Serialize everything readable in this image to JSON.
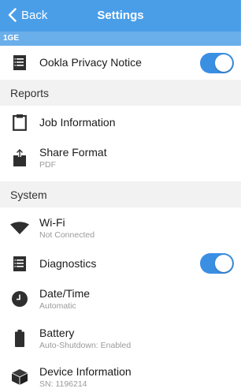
{
  "navbar": {
    "back_label": "Back",
    "title": "Settings"
  },
  "subbar": {
    "label": "1GE"
  },
  "privacy": {
    "title": "Ookla Privacy Notice",
    "toggle_on": true
  },
  "reports": {
    "header": "Reports",
    "items": [
      {
        "title": "Job Information",
        "subtitle": ""
      },
      {
        "title": "Share Format",
        "subtitle": "PDF"
      }
    ]
  },
  "system": {
    "header": "System",
    "items": [
      {
        "title": "Wi-Fi",
        "subtitle": "Not Connected"
      },
      {
        "title": "Diagnostics",
        "subtitle": "",
        "toggle_on": true
      },
      {
        "title": "Date/Time",
        "subtitle": "Automatic"
      },
      {
        "title": "Battery",
        "subtitle": "Auto-Shutdown: Enabled"
      },
      {
        "title": "Device Information",
        "subtitle": "SN: 1196214"
      }
    ]
  },
  "colors": {
    "navbar": "#4a9ee8",
    "subbar": "#6aaeea",
    "toggle": "#3b8fe3",
    "icon": "#2f2f2f"
  }
}
